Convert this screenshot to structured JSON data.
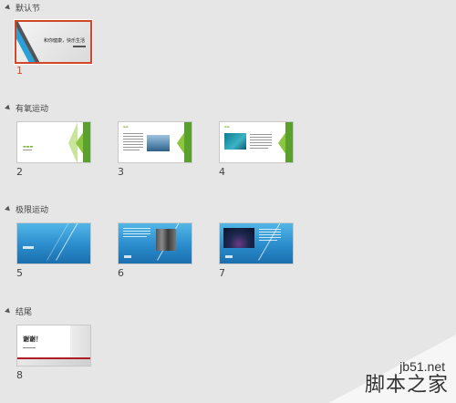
{
  "sections": [
    {
      "name": "默认节",
      "slides": [
        {
          "number": "1",
          "selected": true
        }
      ]
    },
    {
      "name": "有氧运动",
      "slides": [
        {
          "number": "2"
        },
        {
          "number": "3"
        },
        {
          "number": "4"
        }
      ]
    },
    {
      "name": "极限运动",
      "slides": [
        {
          "number": "5"
        },
        {
          "number": "6"
        },
        {
          "number": "7"
        }
      ]
    },
    {
      "name": "结尾",
      "slides": [
        {
          "number": "8"
        }
      ]
    }
  ],
  "slide_content": {
    "s1_title": "和你健康，快乐生活",
    "s8_title": "谢谢！"
  },
  "watermark": {
    "url": "jb51.net",
    "site": "脚本之家"
  },
  "colors": {
    "selection": "#d0472a",
    "green": "#8cc63e",
    "blue": "#2a8ccc",
    "red": "#b01c24"
  }
}
